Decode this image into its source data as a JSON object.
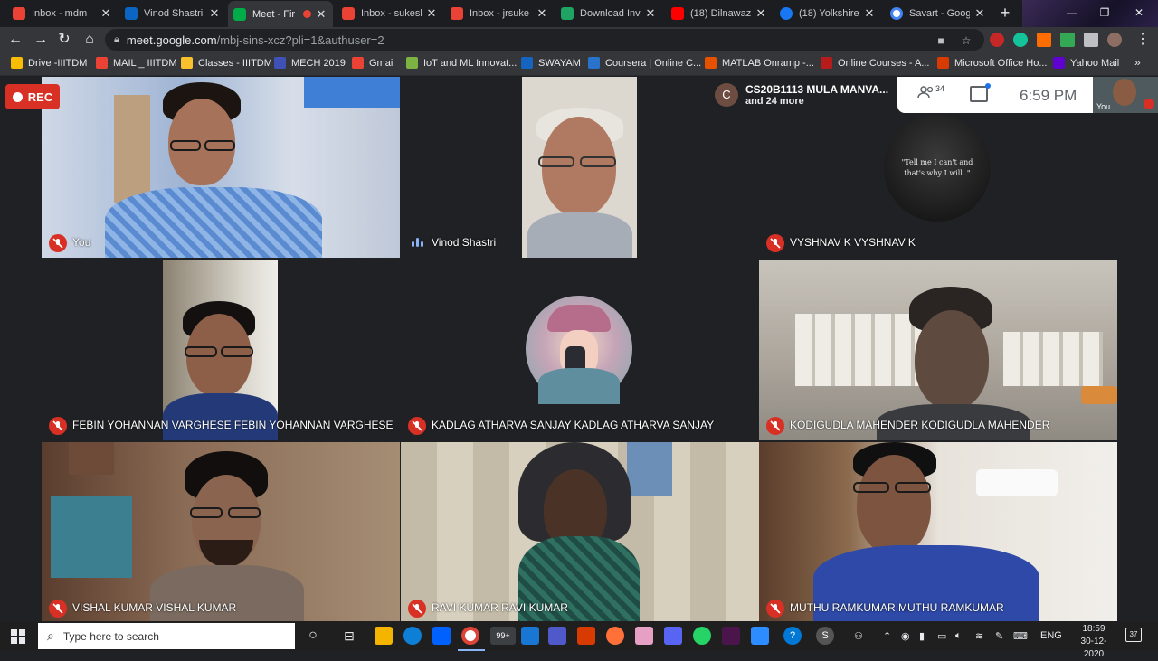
{
  "browser": {
    "tabs": [
      {
        "title": "Inbox - mdm",
        "favicon_color": "#ea4335",
        "active": false
      },
      {
        "title": "Vinod Shastri |",
        "favicon_color": "#0a66c2",
        "active": false
      },
      {
        "title": "Meet - Fir",
        "favicon_color": "#00ac47",
        "active": true,
        "recording": true
      },
      {
        "title": "Inbox - sukesh",
        "favicon_color": "#ea4335",
        "active": false
      },
      {
        "title": "Inbox - jrsuke",
        "favicon_color": "#ea4335",
        "active": false
      },
      {
        "title": "Download Inv",
        "favicon_color": "#1fa463",
        "active": false
      },
      {
        "title": "(18) Dilnawaz",
        "favicon_color": "#ff0000",
        "active": false
      },
      {
        "title": "(18) Yolkshire",
        "favicon_color": "#1877f2",
        "active": false
      },
      {
        "title": "Savart - Goog",
        "favicon_color": "#4285f4",
        "active": false
      }
    ],
    "new_tab": "+",
    "address": {
      "host": "meet.google.com",
      "path": "/mbj-sins-xcz?pli=1&authuser=2"
    },
    "bookmarks": [
      {
        "label": "Drive -IIITDM",
        "color": "#fbbc04"
      },
      {
        "label": "MAIL _ IIITDM",
        "color": "#ea4335"
      },
      {
        "label": "Classes - IIITDM",
        "color": "#fbc02d"
      },
      {
        "label": "MECH 2019",
        "color": "#3f51b5"
      },
      {
        "label": "Gmail",
        "color": "#ea4335"
      },
      {
        "label": "IoT and ML Innovat...",
        "color": "#7cb342"
      },
      {
        "label": "SWAYAM",
        "color": "#1565c0"
      },
      {
        "label": "Coursera | Online C...",
        "color": "#2a73cc"
      },
      {
        "label": "MATLAB Onramp -...",
        "color": "#e65100"
      },
      {
        "label": "Online Courses - A...",
        "color": "#b71c1c"
      },
      {
        "label": "Microsoft Office Ho...",
        "color": "#d83b01"
      },
      {
        "label": "Yahoo Mail",
        "color": "#6001d2"
      }
    ],
    "bookmarks_more": "»"
  },
  "meet": {
    "rec_label": "REC",
    "presenter": {
      "initial": "C",
      "name": "CS20B1113 MULA MANVA...",
      "more": "and 24 more"
    },
    "participant_count": "34",
    "time": "6:59 PM",
    "self_label": "You",
    "tiles": [
      {
        "name": "You",
        "muted": true
      },
      {
        "name": "Vinod Shastri",
        "muted": false
      },
      {
        "name": "VYSHNAV K VYSHNAV K",
        "muted": true
      },
      {
        "name": "FEBIN YOHANNAN VARGHESE FEBIN YOHANNAN VARGHESE",
        "muted": true
      },
      {
        "name": "KADLAG ATHARVA SANJAY KADLAG ATHARVA SANJAY",
        "muted": true
      },
      {
        "name": "KODIGUDLA MAHENDER KODIGUDLA MAHENDER",
        "muted": true
      },
      {
        "name": "VISHAL KUMAR VISHAL KUMAR",
        "muted": true
      },
      {
        "name": "RAVI KUMAR RAVI KUMAR",
        "muted": true
      },
      {
        "name": "MUTHU RAMKUMAR MUTHU RAMKUMAR",
        "muted": true
      }
    ],
    "avatar_quote": "\"Tell me I can't and that's why I will..\""
  },
  "taskbar": {
    "search_placeholder": "Type here to search",
    "chrome_badge": "99+",
    "lang": "ENG",
    "clock_time": "18:59",
    "clock_date": "30-12-2020",
    "notification_count": "37",
    "s_badge": "S"
  }
}
